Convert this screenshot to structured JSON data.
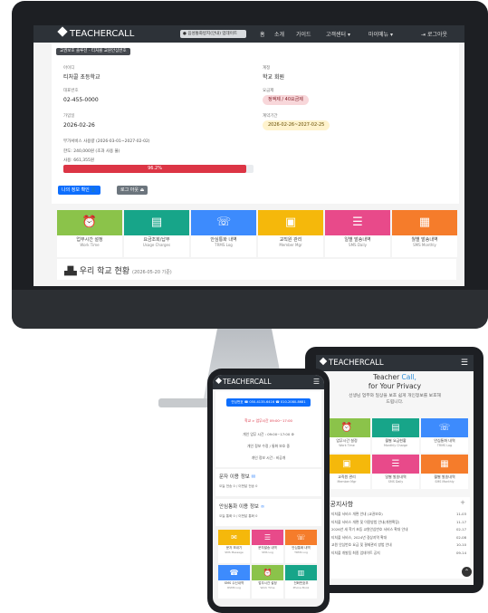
{
  "brand": "TEACHERCALL",
  "desktop": {
    "nav": {
      "notice": "음성통화방지(안내) 업데이트",
      "menu": [
        "홈",
        "소개",
        "가이드",
        "고객센터 ▾",
        "마이메뉴 ▾"
      ],
      "logout": "로그아웃"
    },
    "header_badge": "교권보호 솔루션 - 티처콜 교원안심번호",
    "info": {
      "affiliation_label": "아이디",
      "affiliation_value": "티처콜 초등학교",
      "type_label": "계정",
      "type_value": "학교 회원",
      "phone_label": "대표번호",
      "phone_value": "02-455-0000",
      "plan_label": "요금제",
      "plan_value": "정액제 / 40요금제",
      "joined_label": "가입일",
      "joined_value": "2026-02-26",
      "contract_label": "계약기간",
      "contract_value": "2026-02-26~2027-02-25",
      "usage_label": "부가서비스 사용량 (2026-03-01~2027-02-02)",
      "limit_line": "한도: 240,000원 (초과 사용 불)",
      "used_line": "사용: 661,355원",
      "usage_percent": 96.2,
      "usage_text": "96.2%"
    },
    "buttons": {
      "my_info": "나의 정보 확인 👤",
      "logout": "로그 아웃 ⏏"
    },
    "tiles": [
      {
        "title": "업무시간 설정",
        "sub": "Work Time",
        "color": "#8bc34a",
        "icon": "alarm-clock-icon",
        "glyph": "⏰"
      },
      {
        "title": "요금조회/납부",
        "sub": "Usage Charges",
        "color": "#17a589",
        "icon": "money-icon",
        "glyph": "▤"
      },
      {
        "title": "안심통화 내역",
        "sub": "TRMS Log",
        "color": "#3d8bfd",
        "icon": "phone-icon",
        "glyph": "☏"
      },
      {
        "title": "교직원 관리",
        "sub": "Member Mgr",
        "color": "#f5b80b",
        "icon": "user-card-icon",
        "glyph": "▣"
      },
      {
        "title": "일별 발송내역",
        "sub": "SMS Daily",
        "color": "#e84a8a",
        "icon": "list-icon",
        "glyph": "☰"
      },
      {
        "title": "월별 발송내역",
        "sub": "SMS Monthly",
        "color": "#f57c2b",
        "icon": "document-icon",
        "glyph": "▦"
      }
    ],
    "school_title": "우리 학교 현황",
    "school_date": "(2026-05-20 기준)"
  },
  "tablet": {
    "headline_1": "Teacher",
    "headline_1b": "Call,",
    "headline_2": "for Your Privacy",
    "desc_1": "선생님 업무와 일상을 보호 쉽게 개인정보를 보호해",
    "desc_2": "드립니다.",
    "tiles": [
      {
        "title": "업무시간 설정",
        "sub": "Work Time",
        "color": "#8bc34a",
        "icon": "alarm-clock-icon",
        "glyph": "⏰"
      },
      {
        "title": "월별 요금현황",
        "sub": "Monthly Charge",
        "color": "#17a589",
        "icon": "money-icon",
        "glyph": "▤"
      },
      {
        "title": "안심통화 내역",
        "sub": "TRMS Log",
        "color": "#3d8bfd",
        "icon": "phone-icon",
        "glyph": "☏"
      },
      {
        "title": "교직원 관리",
        "sub": "Member Mgr",
        "color": "#f5b80b",
        "icon": "user-card-icon",
        "glyph": "▣"
      },
      {
        "title": "일별 발송내역",
        "sub": "SMS Daily",
        "color": "#e84a8a",
        "icon": "list-icon",
        "glyph": "☰"
      },
      {
        "title": "월별 발송내역",
        "sub": "SMS Monthly",
        "color": "#f57c2b",
        "icon": "document-icon",
        "glyph": "▦"
      }
    ],
    "notice_title": "공지사항",
    "notice_plus": "+",
    "notices": [
      {
        "text": "티처콜 서비스 개편 안내 (교권보호)",
        "date": "11-03"
      },
      {
        "text": "티처콜 서비스 개편 및 이용방법 안내(개편확장)",
        "date": "11-17"
      },
      {
        "text": "2026년 새 학기 초등 교원안심번호 서비스 확대 안내",
        "date": "02-17"
      },
      {
        "text": "티처콜 서비스, 2024년 경상지역 확대",
        "date": "02-08"
      },
      {
        "text": "교원 안심번호 요금 및 결제관리 방법 안내",
        "date": "10-10"
      },
      {
        "text": "티처콜 개발팀 최종 업데이트 공지",
        "date": "09-14"
      }
    ],
    "up_button": "⌃",
    "footer_text": "TEACHERCALL"
  },
  "phone": {
    "number_chip": "안심번호 ☎ 050-4135-6416 ☎ 010-2080-8681",
    "hours_line": "학교 > 업무시간 09:00~17:00",
    "time_line": "개인 업무 시간 : 09:00~17:00 ⚙",
    "status_line": "개인 정보 수정 / 통화 보호 중",
    "limit_line": "개인 정보 시간 : 비공개",
    "sms_title": "문자 이용 정보",
    "sms_line": "오늘 전송 0 / 이번달 전송 0",
    "call_title": "안심통화 이용 정보",
    "call_line": "오늘 통화 0 / 이번달 통화 0",
    "tiles": [
      {
        "title": "문자 보내기",
        "sub": "SMS Message",
        "color": "#f5b80b",
        "icon": "message-icon",
        "glyph": "✉"
      },
      {
        "title": "문자발송 내역",
        "sub": "SMS Log",
        "color": "#e84a8a",
        "icon": "list-icon",
        "glyph": "☰"
      },
      {
        "title": "안심통화 내역",
        "sub": "TRMS Log",
        "color": "#f57c2b",
        "icon": "phone-icon",
        "glyph": "☏"
      },
      {
        "title": "SMS 수신내역",
        "sub": "RSMS Log",
        "color": "#3d8bfd",
        "icon": "phone-call-icon",
        "glyph": "☎"
      },
      {
        "title": "업무시간 설정",
        "sub": "Work Time",
        "color": "#8bc34a",
        "icon": "alarm-clock-icon",
        "glyph": "⏰"
      },
      {
        "title": "전화번호부",
        "sub": "Phone Book",
        "color": "#17a589",
        "icon": "book-icon",
        "glyph": "▥"
      }
    ]
  }
}
